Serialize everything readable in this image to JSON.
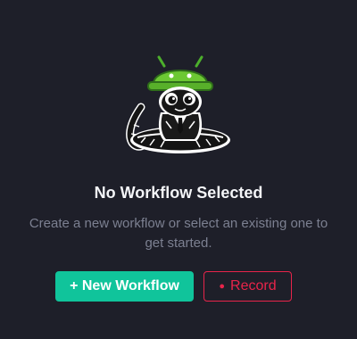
{
  "empty_state": {
    "mascot_icon": "android-snake-mascot",
    "title": "No Workflow Selected",
    "subtitle": "Create a new workflow or select an existing one to get started."
  },
  "actions": {
    "new_workflow_label": "+ New Workflow",
    "record_dot": "●",
    "record_label": "Record"
  },
  "colors": {
    "background": "#1e1f29",
    "title": "#f4f5f8",
    "subtitle": "#7c8091",
    "primary": "#10c49b",
    "record": "#e8244a"
  }
}
